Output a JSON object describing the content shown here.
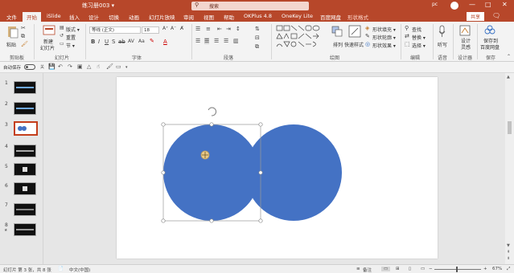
{
  "titlebar": {
    "doc_title": "练习册003 ▾",
    "search_placeholder": "搜索",
    "user_name": "pc",
    "controls": [
      "—",
      "□",
      "✕"
    ]
  },
  "tabs": [
    "文件",
    "开始",
    "iSlide",
    "插入",
    "设计",
    "切换",
    "动画",
    "幻灯片放映",
    "审阅",
    "视图",
    "帮助",
    "OKPlus 4.8",
    "OneKey Lite",
    "百度网盘",
    "形状格式"
  ],
  "active_tab": "开始",
  "share_label": "共享",
  "ribbon": {
    "groups": {
      "clipboard": "剪贴板",
      "slides": "幻灯片",
      "font": "字体",
      "paragraph": "段落",
      "drawing": "绘图",
      "editing": "编辑",
      "voice": "语音",
      "designer": "设计器",
      "save": "保存"
    },
    "paste": "粘贴",
    "new_slide_line1": "新建",
    "new_slide_line2": "幻灯片",
    "layout": "版式 ▾",
    "reset": "重置",
    "section": "节 ▾",
    "font_name": "等线 (正文)",
    "font_size": "18",
    "arrange": "排列",
    "quick_styles": "快速样式",
    "shape_fill": "形状填充 ▾",
    "shape_outline": "形状轮廓 ▾",
    "shape_effects": "形状效果 ▾",
    "find": "查找",
    "replace": "替换 ▾",
    "select": "选择 ▾",
    "dictate": "听写",
    "design_ideas_line1": "设计",
    "design_ideas_line2": "灵感",
    "save_baidu_line1": "保存到",
    "save_baidu_line2": "百度网盘"
  },
  "qat": {
    "autosave_label": "自动保存",
    "autosave_state": "关"
  },
  "slides": [
    {
      "num": "1",
      "style": "dark",
      "star": false
    },
    {
      "num": "2",
      "style": "dark",
      "star": false
    },
    {
      "num": "3",
      "style": "circles",
      "star": false
    },
    {
      "num": "4",
      "style": "dark",
      "star": false
    },
    {
      "num": "5",
      "style": "dark",
      "star": false
    },
    {
      "num": "6",
      "style": "dark",
      "star": false
    },
    {
      "num": "7",
      "style": "dark",
      "star": false
    },
    {
      "num": "8",
      "style": "dark",
      "star": true
    }
  ],
  "active_slide": 3,
  "shape_color": "#4472c4",
  "accent_color": "#b7472a",
  "status": {
    "slide_info": "幻灯片 第 3 张，共 8 张",
    "language": "中文(中国)",
    "notes": "备注",
    "zoom": "67%"
  }
}
